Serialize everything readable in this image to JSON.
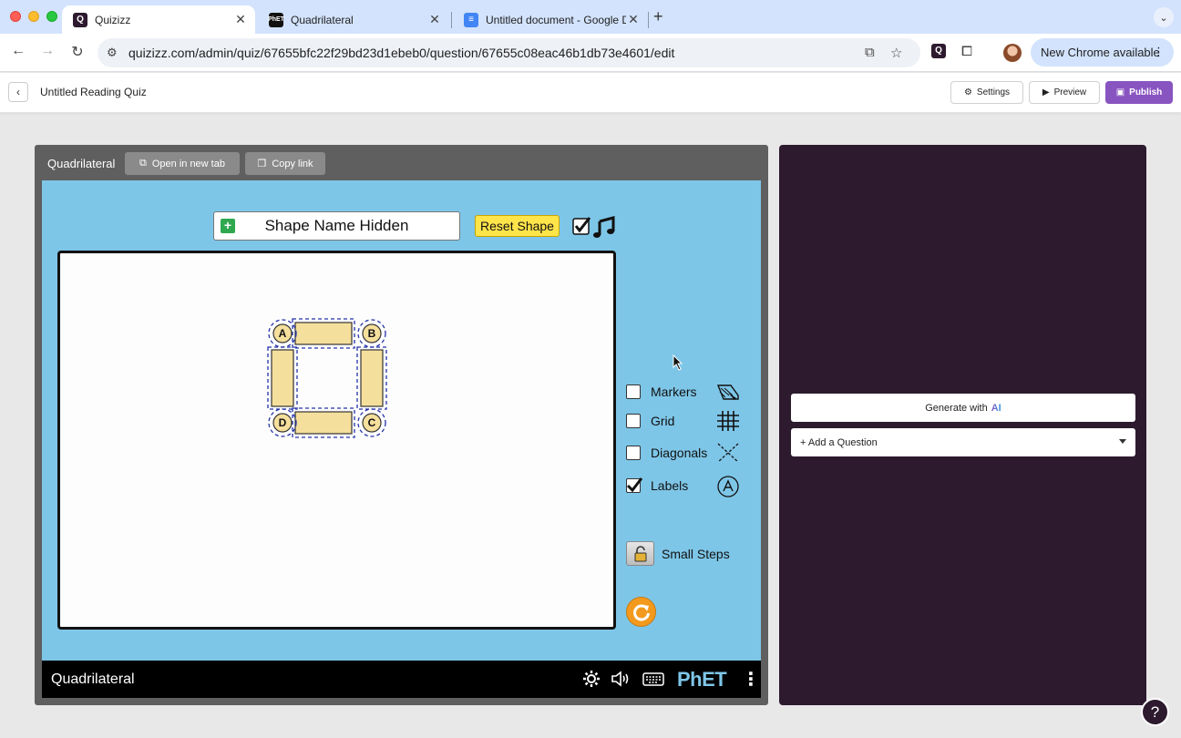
{
  "browser": {
    "tabs": [
      {
        "title": "Quizizz",
        "favicon": "quizizz-logo",
        "active": true
      },
      {
        "title": "Quadrilateral",
        "favicon": "phet-logo",
        "active": false
      },
      {
        "title": "Untitled document - Google D",
        "favicon": "google-docs-logo",
        "active": false
      }
    ],
    "new_tab_label": "+",
    "url": "quizizz.com/admin/quiz/67655bfc22f29bd23d1ebeb0/question/67655c08eac46b1db73e4601/edit",
    "update_label": "New Chrome available"
  },
  "header": {
    "quiz_title": "Untitled Reading Quiz",
    "settings_label": "Settings",
    "preview_label": "Preview",
    "publish_label": "Publish"
  },
  "embed": {
    "title": "Quadrilateral",
    "open_new_tab_label": "Open in new tab",
    "copy_link_label": "Copy link"
  },
  "sim": {
    "shape_name_label": "Shape Name Hidden",
    "reset_shape_label": "Reset Shape",
    "sound_checked": true,
    "vertex_labels": [
      "A",
      "B",
      "C",
      "D"
    ],
    "options": [
      {
        "label": "Markers",
        "checked": false,
        "icon": "markers-icon"
      },
      {
        "label": "Grid",
        "checked": false,
        "icon": "grid-icon"
      },
      {
        "label": "Diagonals",
        "checked": false,
        "icon": "diagonals-icon"
      },
      {
        "label": "Labels",
        "checked": true,
        "icon": "labels-icon"
      }
    ],
    "small_steps_label": "Small Steps",
    "nav_title": "Quadrilateral",
    "phet_logo_text": "PhET"
  },
  "panel": {
    "generate_label": "Generate with",
    "generate_ai": "AI",
    "add_question_label": "+ Add a Question"
  },
  "help_label": "?"
}
